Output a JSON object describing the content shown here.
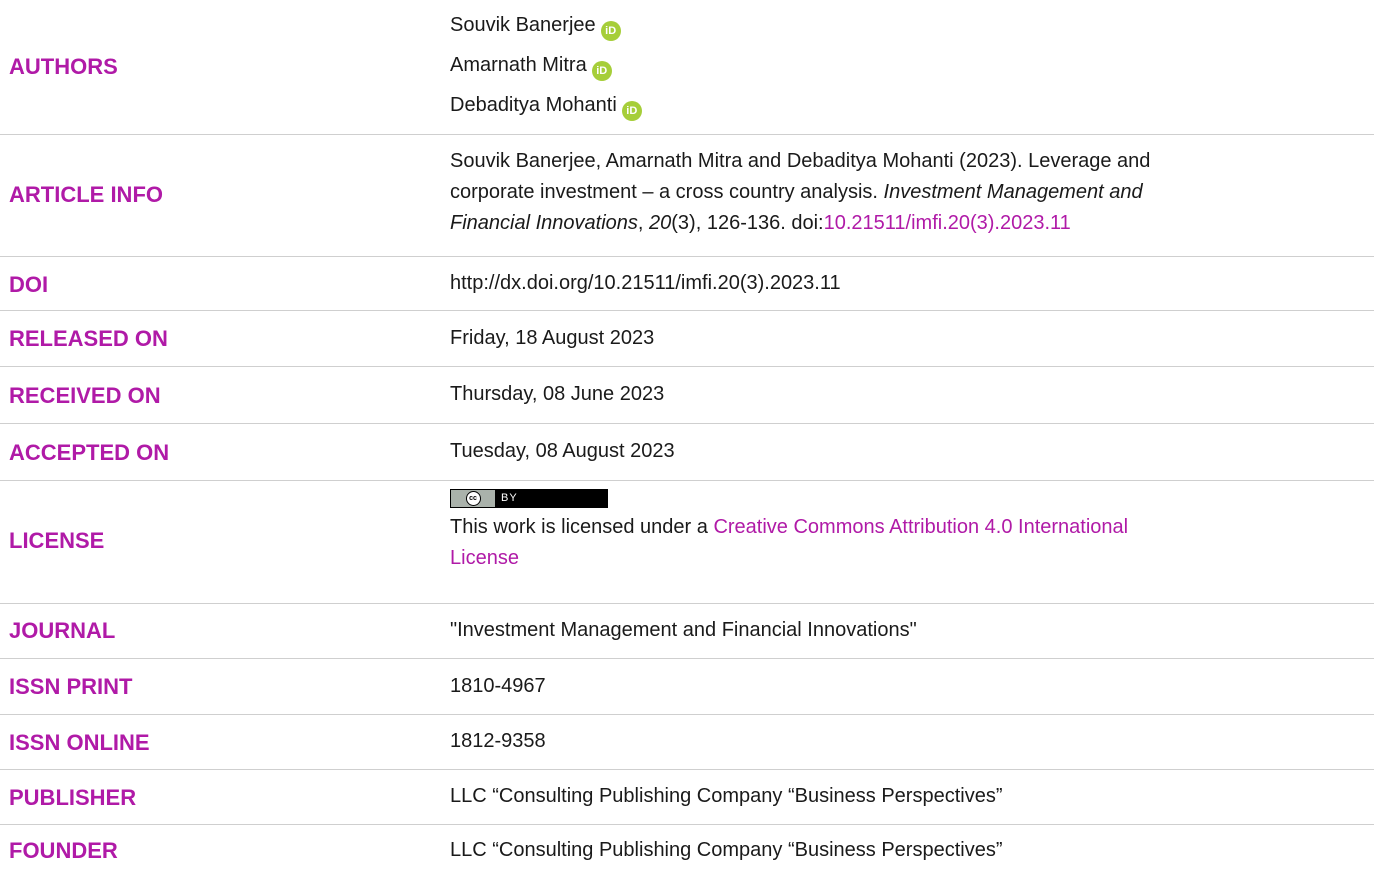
{
  "authors": {
    "label": "AUTHORS",
    "names": [
      "Souvik Banerjee",
      "Amarnath Mitra",
      "Debaditya Mohanti"
    ],
    "orcid_icon": "orcid-icon",
    "orcid_glyph": "iD"
  },
  "article_info": {
    "label": "ARTICLE INFO",
    "line1": "Souvik Banerjee, Amarnath Mitra and Debaditya Mohanti (2023). Leverage and",
    "line2_text": "corporate investment – a cross country analysis.",
    "line2_journal": "Investment Management and",
    "line3_journal": "Financial Innovations",
    "line3_sep": ", ",
    "line3_volume": "20",
    "line3_rest": "(3), 126-136. doi:",
    "doi_link": "10.21511/imfi.20(3).2023.11"
  },
  "doi": {
    "label": "DOI",
    "value": "http://dx.doi.org/10.21511/imfi.20(3).2023.11"
  },
  "released": {
    "label": "RELEASED ON",
    "value": "Friday, 18 August 2023"
  },
  "received": {
    "label": "RECEIVED ON",
    "value": "Thursday, 08 June 2023"
  },
  "accepted": {
    "label": "ACCEPTED ON",
    "value": "Tuesday, 08 August 2023"
  },
  "license": {
    "label": "LICENSE",
    "badge_cc": "cc",
    "badge_by": "BY",
    "text_prefix": "This work is licensed under a ",
    "link_line1": "Creative Commons Attribution 4.0 International",
    "link_line2": "License"
  },
  "journal": {
    "label": "JOURNAL",
    "value": "\"Investment Management and Financial Innovations\""
  },
  "issn_print": {
    "label": "ISSN PRINT",
    "value": "1810-4967"
  },
  "issn_online": {
    "label": "ISSN ONLINE",
    "value": "1812-9358"
  },
  "publisher": {
    "label": "PUBLISHER",
    "value": "LLC “Consulting Publishing Company “Business Perspectives”"
  },
  "founder": {
    "label": "FOUNDER",
    "value": "LLC “Consulting Publishing Company “Business Perspectives”"
  },
  "colors": {
    "label": "#b01aa7",
    "orcid": "#a6ce39",
    "text": "#1a1a1a",
    "divider": "#cfcfcf"
  }
}
